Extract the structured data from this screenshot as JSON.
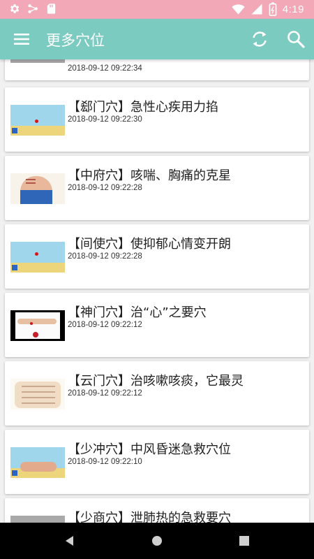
{
  "status_bar": {
    "time": "4:19"
  },
  "app_bar": {
    "title": "更多穴位"
  },
  "articles": [
    {
      "title": "",
      "date": "2018-09-12 09:22:34"
    },
    {
      "title": "【郄门穴】急性心疾用力掐",
      "date": "2018-09-12 09:22:30"
    },
    {
      "title": "【中府穴】咳喘、胸痛的克星",
      "date": "2018-09-12 09:22:28"
    },
    {
      "title": "【间使穴】使抑郁心情变开朗",
      "date": "2018-09-12 09:22:28"
    },
    {
      "title": "【神门穴】治“心”之要穴",
      "date": "2018-09-12 09:22:12"
    },
    {
      "title": "【云门穴】治咳嗽咳痰，它最灵",
      "date": "2018-09-12 09:22:12"
    },
    {
      "title": "【少冲穴】中风昏迷急救穴位",
      "date": "2018-09-12 09:22:10"
    },
    {
      "title": "【少商穴】泄肺热的急救要穴",
      "date": ""
    }
  ],
  "colors": {
    "status_bar": "#f3a8b8",
    "app_bar": "#7ccbc0",
    "list_bg": "#f1f1f1"
  },
  "icons": {
    "status_left": [
      "gear-icon",
      "network-icon",
      "sd-card-icon"
    ],
    "status_right": [
      "wifi-icon",
      "signal-icon",
      "battery-icon"
    ],
    "app_bar": [
      "menu-icon",
      "refresh-icon",
      "search-icon"
    ],
    "nav": [
      "back-icon",
      "home-icon",
      "recents-icon"
    ]
  }
}
